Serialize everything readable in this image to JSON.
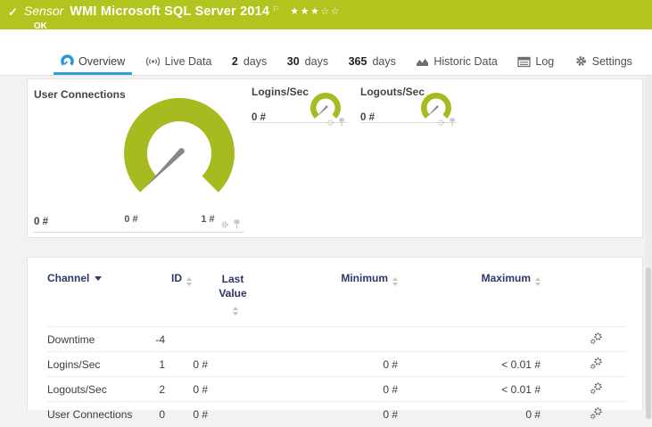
{
  "statusbar": {
    "sensor_label": "Sensor",
    "title": "WMI Microsoft SQL Server 2014",
    "status": "OK",
    "stars_filled": "★★★",
    "stars_empty": "☆☆"
  },
  "tabs": {
    "overview": "Overview",
    "live_data": "Live Data",
    "d2_num": "2",
    "d2_label": "days",
    "d30_num": "30",
    "d30_label": "days",
    "d365_num": "365",
    "d365_label": "days",
    "historic": "Historic Data",
    "log": "Log",
    "settings": "Settings"
  },
  "gauges": {
    "user_connections": {
      "title": "User Connections",
      "value": "0 #",
      "scale_min": "0 #",
      "scale_max": "1 #"
    },
    "logins": {
      "title": "Logins/Sec",
      "value": "0 #"
    },
    "logouts": {
      "title": "Logouts/Sec",
      "value": "0 #"
    }
  },
  "table": {
    "headers": {
      "channel": "Channel",
      "id": "ID",
      "last": "Last Value",
      "min": "Minimum",
      "max": "Maximum"
    },
    "rows": [
      {
        "channel": "Downtime",
        "id": "-4",
        "last": "",
        "min": "",
        "max": ""
      },
      {
        "channel": "Logins/Sec",
        "id": "1",
        "last": "0 #",
        "min": "0 #",
        "max": "< 0.01 #"
      },
      {
        "channel": "Logouts/Sec",
        "id": "2",
        "last": "0 #",
        "min": "0 #",
        "max": "< 0.01 #"
      },
      {
        "channel": "User Connections",
        "id": "0",
        "last": "0 #",
        "min": "0 #",
        "max": "0 #"
      }
    ]
  },
  "colors": {
    "status_green": "#b2c41e",
    "gauge_green": "#a7bb21",
    "accent_blue": "#2da0d8",
    "header_navy": "#2f3768"
  }
}
